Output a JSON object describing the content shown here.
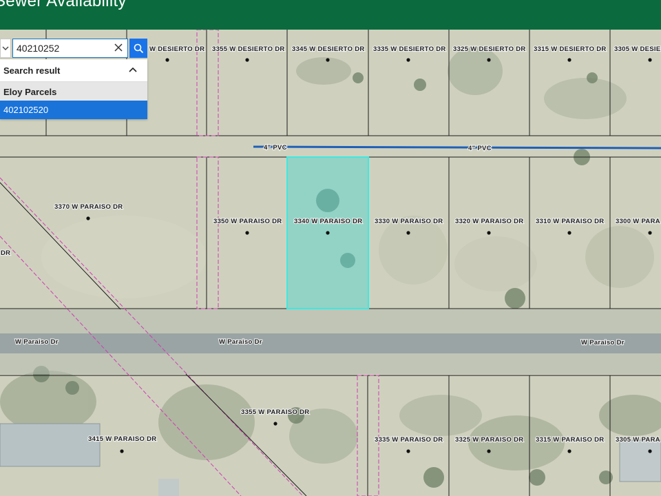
{
  "header": {
    "title": "Sewer Availability"
  },
  "search": {
    "value": "40210252",
    "placeholder": ""
  },
  "results": {
    "title": "Search result",
    "group_label": "Eloy Parcels",
    "items": [
      "402102520"
    ]
  },
  "map": {
    "colors": {
      "parcel_line": "#1c1c1c",
      "sewer_main": "#1f5fb8",
      "selected_parcel": "#3fe8e0",
      "easement_line": "#d23bb4",
      "road": "#8e9797"
    },
    "icons": [
      "search-icon",
      "close-icon",
      "chevron-up-icon",
      "chevron-down-icon"
    ],
    "parcels_row1": [
      "W DESIERTO DR",
      "3355 W DESIERTO DR",
      "3345 W DESIERTO DR",
      "3335 W DESIERTO DR",
      "3325 W DESIERTO DR",
      "3315 W DESIERTO DR",
      "3305 W DESIE"
    ],
    "parcels_row2": [
      "3370 W PARAISO DR",
      "3350 W PARAISO DR",
      "3340 W PARAISO DR",
      "3330 W PARAISO DR",
      "3320 W PARAISO DR",
      "3310 W PARAISO DR",
      "3300 W PARA"
    ],
    "parcels_row3": [
      "3415 W PARAISO DR",
      "3355 W PARAISO DR",
      "3335 W PARAISO DR",
      "3325 W PARAISO DR",
      "3315 W PARAISO DR",
      "3305 W PARA"
    ],
    "pipe_labels": [
      "4\" PVC",
      "4\" PVC"
    ],
    "road_labels": [
      "W Paraiso Dr",
      "W Paraiso Dr",
      "W Paraiso Dr"
    ],
    "edge_label": "DR"
  }
}
